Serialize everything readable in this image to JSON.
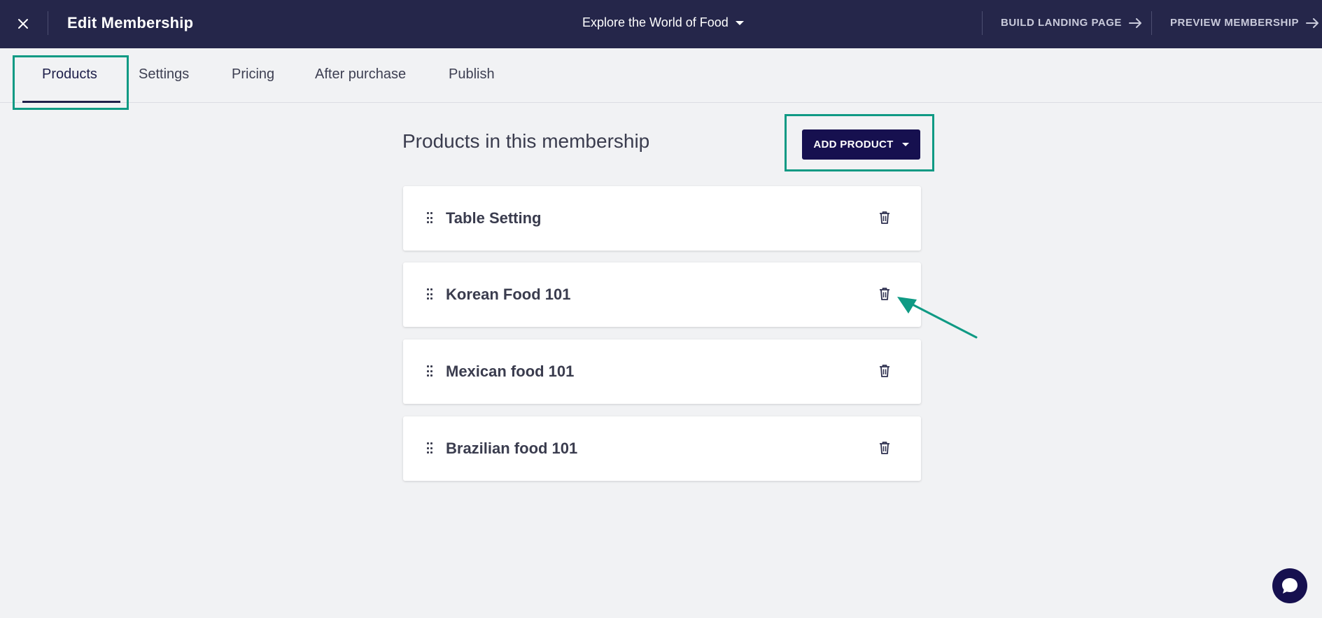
{
  "header": {
    "title": "Edit Membership",
    "membership_selector": "Explore the World of Food",
    "build_landing_label": "BUILD LANDING PAGE",
    "preview_label": "PREVIEW MEMBERSHIP"
  },
  "tabs": [
    {
      "label": "Products",
      "active": true
    },
    {
      "label": "Settings",
      "active": false
    },
    {
      "label": "Pricing",
      "active": false
    },
    {
      "label": "After purchase",
      "active": false
    },
    {
      "label": "Publish",
      "active": false
    }
  ],
  "main": {
    "section_title": "Products in this membership",
    "add_product_label": "ADD PRODUCT",
    "products": [
      {
        "name": "Table Setting"
      },
      {
        "name": "Korean Food 101"
      },
      {
        "name": "Mexican food 101"
      },
      {
        "name": "Brazilian food 101"
      }
    ]
  },
  "colors": {
    "topbar": "#25264a",
    "accent": "#16104f",
    "highlight": "#0f9a84",
    "background": "#f1f2f4"
  },
  "icons": [
    "close-icon",
    "chevron-down-icon",
    "arrow-right-icon",
    "drag-handle-icon",
    "trash-icon",
    "chat-icon"
  ]
}
